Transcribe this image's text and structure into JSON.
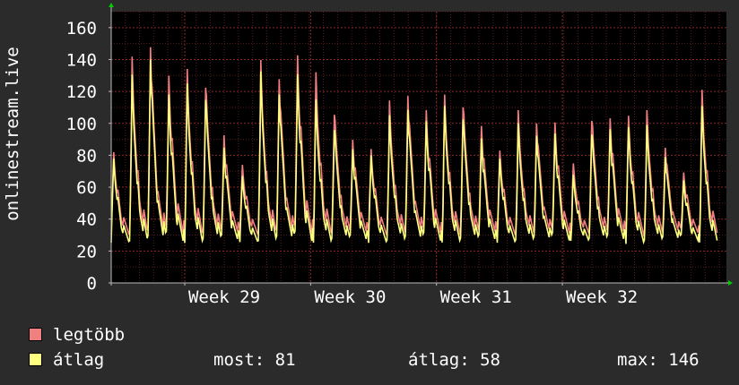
{
  "chart_data": {
    "type": "line",
    "ylabel": "onlinestream.live",
    "ylim": [
      0,
      170
    ],
    "yticks": [
      0,
      20,
      40,
      60,
      80,
      100,
      120,
      140,
      160
    ],
    "x_range": [
      0,
      43.5
    ],
    "xticks": [
      {
        "label": "Week 29",
        "x": 5.2
      },
      {
        "label": "Week 30",
        "x": 14.1
      },
      {
        "label": "Week 31",
        "x": 23.0
      },
      {
        "label": "Week 32",
        "x": 31.9
      }
    ],
    "grid": true,
    "legend_position": "bottom-left",
    "day_peaks": [
      {
        "day": 0,
        "max": 82,
        "avg": 78
      },
      {
        "day": 1,
        "max": 139,
        "avg": 128
      },
      {
        "day": 2,
        "max": 154,
        "avg": 146
      },
      {
        "day": 3,
        "max": 132,
        "avg": 120
      },
      {
        "day": 4,
        "max": 133,
        "avg": 124
      },
      {
        "day": 5,
        "max": 129,
        "avg": 121
      },
      {
        "day": 6,
        "max": 95,
        "avg": 87
      },
      {
        "day": 7,
        "max": 74,
        "avg": 67
      },
      {
        "day": 8,
        "max": 137,
        "avg": 130
      },
      {
        "day": 9,
        "max": 133,
        "avg": 123
      },
      {
        "day": 10,
        "max": 145,
        "avg": 133
      },
      {
        "day": 11,
        "max": 131,
        "avg": 114
      },
      {
        "day": 12,
        "max": 111,
        "avg": 101
      },
      {
        "day": 13,
        "max": 92,
        "avg": 86
      },
      {
        "day": 14,
        "max": 84,
        "avg": 80
      },
      {
        "day": 15,
        "max": 112,
        "avg": 103
      },
      {
        "day": 16,
        "max": 122,
        "avg": 113
      },
      {
        "day": 17,
        "max": 110,
        "avg": 103
      },
      {
        "day": 18,
        "max": 117,
        "avg": 110
      },
      {
        "day": 19,
        "max": 116,
        "avg": 108
      },
      {
        "day": 20,
        "max": 101,
        "avg": 93
      },
      {
        "day": 21,
        "max": 83,
        "avg": 78
      },
      {
        "day": 22,
        "max": 106,
        "avg": 98
      },
      {
        "day": 23,
        "max": 104,
        "avg": 96
      },
      {
        "day": 24,
        "max": 102,
        "avg": 95
      },
      {
        "day": 25,
        "max": 74,
        "avg": 67
      },
      {
        "day": 26,
        "max": 107,
        "avg": 98
      },
      {
        "day": 27,
        "max": 106,
        "avg": 99
      },
      {
        "day": 28,
        "max": 105,
        "avg": 98
      },
      {
        "day": 29,
        "max": 106,
        "avg": 97
      },
      {
        "day": 30,
        "max": 88,
        "avg": 82
      },
      {
        "day": 31,
        "max": 70,
        "avg": 65
      },
      {
        "day": 32,
        "max": 120,
        "avg": 110
      }
    ],
    "series": [
      {
        "name": "legtöbb",
        "color": "#f08080"
      },
      {
        "name": "átlag",
        "color": "#ffff80"
      }
    ]
  },
  "legend": {
    "max_label": "legtöbb",
    "avg_label": "átlag"
  },
  "stats": {
    "current": "most: 81",
    "average": "átlag: 58",
    "maximum": "max: 146"
  }
}
